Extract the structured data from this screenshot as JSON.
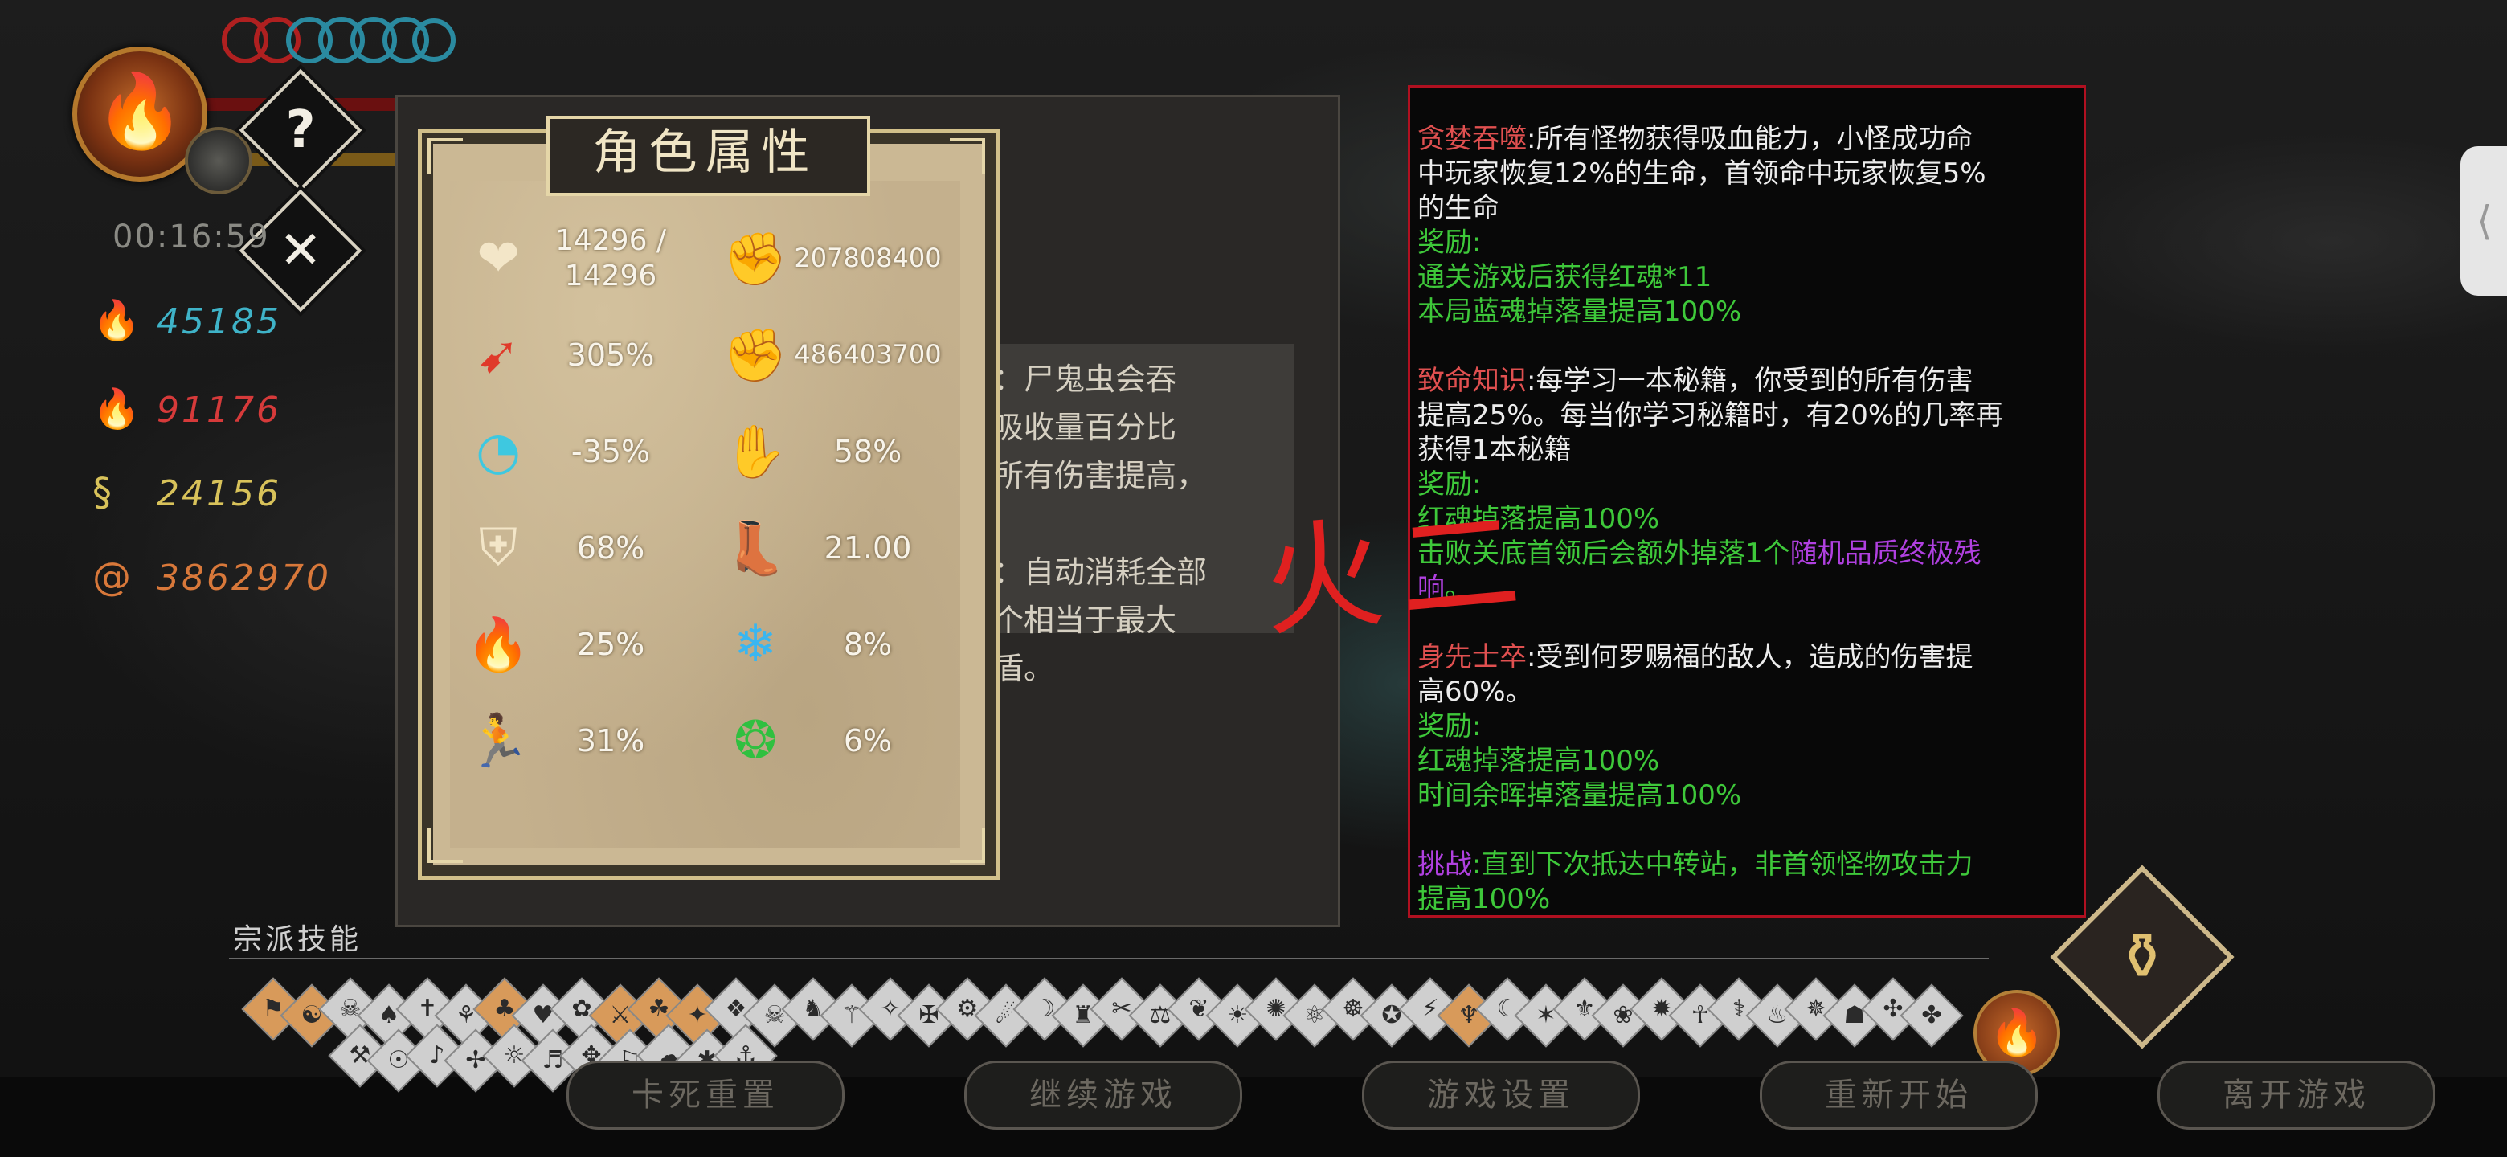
{
  "hud": {
    "timer": "00:16:59",
    "help_icon": "?",
    "close_icon": "✕",
    "resources": [
      {
        "icon": "blue-soul-icon",
        "glyph": "🔥",
        "value": "45185",
        "color": "#3fb3c8"
      },
      {
        "icon": "red-soul-icon",
        "glyph": "🔥",
        "value": "91176",
        "color": "#d63a3a"
      },
      {
        "icon": "yellow-soul-icon",
        "glyph": "§",
        "value": "24156",
        "color": "#d8c25a"
      },
      {
        "icon": "coin-icon",
        "glyph": "@",
        "value": "3862970",
        "color": "#d8783a"
      }
    ]
  },
  "behind_panel": {
    "desc_text": "：尸鬼虫会吞\n吸收量百分比\n所有伤害提高，\n\n：自动消耗全部\n个相当于最大\n盾。"
  },
  "attributes": {
    "title": "角色属性",
    "stats": [
      {
        "icon": "heart-icon",
        "glyph": "❤",
        "color": "#f3e6c8",
        "value": "14296 /\n14296"
      },
      {
        "icon": "attack-fist-icon",
        "glyph": "✊",
        "color": "#e03a2a",
        "value": "207808400"
      },
      {
        "icon": "crit-rate-icon",
        "glyph": "➹",
        "color": "#e03a2a",
        "value": "305%"
      },
      {
        "icon": "blue-attack-icon",
        "glyph": "✊",
        "color": "#3ec8e0",
        "value": "486403700"
      },
      {
        "icon": "cooldown-icon",
        "glyph": "◔",
        "color": "#3ec8e0",
        "value": "-35%"
      },
      {
        "icon": "armor-break-icon",
        "glyph": "✋",
        "color": "#f3e6c8",
        "value": "58%"
      },
      {
        "icon": "shield-icon",
        "glyph": "⛨",
        "color": "#f3e6c8",
        "value": "68%"
      },
      {
        "icon": "boot-speed-icon",
        "glyph": "👢",
        "color": "#f3e6c8",
        "value": "21.00"
      },
      {
        "icon": "fire-icon",
        "glyph": "🔥",
        "color": "#f08a20",
        "value": "25%"
      },
      {
        "icon": "snowflake-icon",
        "glyph": "❄",
        "color": "#3ab6f0",
        "value": "8%"
      },
      {
        "icon": "dodge-runner-icon",
        "glyph": "🏃",
        "color": "#f0d040",
        "value": "31%"
      },
      {
        "icon": "poison-bubbles-icon",
        "glyph": "❂",
        "color": "#30c040",
        "value": "6%"
      }
    ]
  },
  "annotation": "火二",
  "quest_panel": {
    "lines": [
      [
        {
          "t": "贪婪吞噬",
          "c": "red"
        },
        {
          "t": ":所有怪物获得吸血能力，小怪成功命",
          "c": "white"
        }
      ],
      [
        {
          "t": "中玩家恢复12%的生命，首领命中玩家恢复5%",
          "c": "white"
        }
      ],
      [
        {
          "t": "的生命",
          "c": "white"
        }
      ],
      [
        {
          "t": "奖励:",
          "c": "green"
        }
      ],
      [
        {
          "t": "通关游戏后获得红魂*11",
          "c": "green"
        }
      ],
      [
        {
          "t": "本局蓝魂掉落量提高100%",
          "c": "green"
        }
      ],
      [],
      [
        {
          "t": "致命知识",
          "c": "red"
        },
        {
          "t": ":每学习一本秘籍，你受到的所有伤害",
          "c": "white"
        }
      ],
      [
        {
          "t": "提高25%。每当你学习秘籍时，有20%的几率再",
          "c": "white"
        }
      ],
      [
        {
          "t": "获得1本秘籍",
          "c": "white"
        }
      ],
      [
        {
          "t": "奖励:",
          "c": "green"
        }
      ],
      [
        {
          "t": "红魂掉落提高100%",
          "c": "green"
        }
      ],
      [
        {
          "t": "击败关底首领后会额外掉落1个",
          "c": "green"
        },
        {
          "t": "随机品质终极残",
          "c": "purple"
        }
      ],
      [
        {
          "t": "响",
          "c": "purple"
        },
        {
          "t": "。",
          "c": "green"
        }
      ],
      [],
      [
        {
          "t": "身先士卒",
          "c": "red"
        },
        {
          "t": ":受到何罗赐福的敌人，造成的伤害提",
          "c": "white"
        }
      ],
      [
        {
          "t": "高60%。",
          "c": "white"
        }
      ],
      [
        {
          "t": "奖励:",
          "c": "green"
        }
      ],
      [
        {
          "t": "红魂掉落提高100%",
          "c": "green"
        }
      ],
      [
        {
          "t": "时间余晖掉落量提高100%",
          "c": "green"
        }
      ],
      [],
      [
        {
          "t": "挑战",
          "c": "purple"
        },
        {
          "t": ":直到下次抵达中转站，非首领怪物攻击力",
          "c": "green"
        }
      ],
      [
        {
          "t": "提高100%",
          "c": "green"
        }
      ]
    ]
  },
  "skills": {
    "label": "宗派技能",
    "row1": [
      "⚑",
      "☯",
      "☠",
      "♠",
      "✝",
      "⚘",
      "♣",
      "♥",
      "✿",
      "⚔",
      "☘",
      "✦",
      "❖",
      "☠",
      "♞",
      "⚚",
      "✧",
      "✠",
      "⚙",
      "☄",
      "☽",
      "♜",
      "✂",
      "⚖",
      "❦",
      "☀",
      "✺",
      "⚛",
      "☸",
      "✪",
      "⚡",
      "♆",
      "☾",
      "✶",
      "⚜",
      "❀",
      "✹",
      "☥",
      "⚕",
      "♨",
      "✵",
      "☗",
      "✣",
      "✤"
    ],
    "row2": [
      "⚒",
      "☉",
      "♪",
      "✢",
      "☼",
      "♬",
      "✥",
      "⚐",
      "☁",
      "✱",
      "⚓"
    ],
    "highlighted_row1": [
      0,
      1,
      6,
      9,
      10,
      11,
      31
    ]
  },
  "lamp_icon": "lamp-icon",
  "side_tab": "⟨",
  "menu": {
    "buttons": [
      "卡死重置",
      "继续游戏",
      "游戏设置",
      "重新开始",
      "离开游戏"
    ]
  }
}
